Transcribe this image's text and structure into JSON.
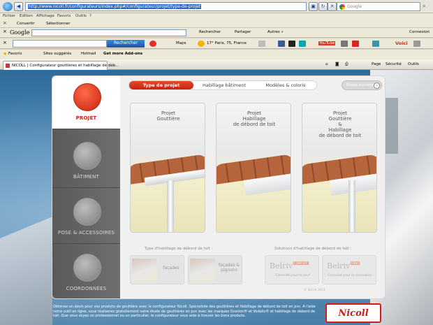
{
  "browser": {
    "address_url": "http://www.nicoll.fr/configurateurs/index.php#/configurateur/projet/type-de-projet",
    "search_placeholder": "Google",
    "menu": [
      "Fichier",
      "Edition",
      "Affichage",
      "Favoris",
      "Outils",
      "?"
    ],
    "links_toolbar": [
      "Convertir",
      "Sélectionner"
    ],
    "google_toolbar": {
      "logo": "Google",
      "items": [
        "Rechercher",
        "Partager",
        "Autres »",
        "Connexion"
      ]
    },
    "bing_toolbar": {
      "search_button": "Rechercher",
      "items": [
        "Maps",
        "17° Paris, 75, France",
        "YouTube",
        "Voici"
      ]
    },
    "favorites_bar": {
      "favoris": "Favoris",
      "items": [
        "Sites suggérés",
        "Hotmail",
        "Get more Add-ons"
      ]
    },
    "tab": {
      "title": "NICOLL | Configurateur gouttières et habillage de déb..."
    },
    "tab_tools": [
      "Page",
      "Sécurité",
      "Outils"
    ]
  },
  "configurator": {
    "sidebar": [
      {
        "label": "PROJET",
        "active": true
      },
      {
        "label": "BÂTIMENT",
        "active": false
      },
      {
        "label": "POSE & ACCESSOIRES",
        "active": false
      },
      {
        "label": "COORDONNÉES",
        "active": false
      }
    ],
    "nav_tabs": [
      {
        "label": "Type de projet",
        "active": true
      },
      {
        "label": "Habillage bâtiment",
        "active": false
      },
      {
        "label": "Modèles & coloris",
        "active": false
      }
    ],
    "back_button": "Etape suivante",
    "cards": [
      {
        "title": "Projet\nGouttière"
      },
      {
        "title": "Projet\nHabillage\nde débord de toit"
      },
      {
        "title": "Projet\nGouttière\n&\nHabillage\nde débord de toit"
      }
    ],
    "habillage_section": {
      "title": "Type d'habillage de débord de toit :",
      "options": [
        "façades",
        "façades & pignons"
      ]
    },
    "solutions_section": {
      "title": "Solutions d'habillage de débord de toit :",
      "brands": [
        {
          "name": "Belriv",
          "tag": "COMFORT",
          "sub": "Conseillé pour le neuf"
        },
        {
          "name": "Belriv",
          "tag": "RÉNO",
          "sub": "Conseillé pour la rénovation"
        }
      ]
    },
    "footer": "© Nicoll 2011"
  },
  "page": {
    "intro_text": "Obtenez un devis pour vos produits de gouttière avec le configurateur Nicoll. Spécialiste des gouttières et Habillage de débord de toit en pvc. A l'aide notre outil en ligne, vous réaliserez gratuitement votre étude de gouttières en pvc avec les marques Ovation® et Vodalis® et habillage de débord de toit. Que vous soyez un professionnel ou un particulier, le configurateur vous aide à trouver les bons produits.",
    "logo": "Nicoll"
  },
  "colors": {
    "accent_red": "#c8230b",
    "sidebar_gray": "#5a5a5a",
    "panel_bg": "#f0f0f0",
    "nicoll_red": "#d51a1a"
  }
}
